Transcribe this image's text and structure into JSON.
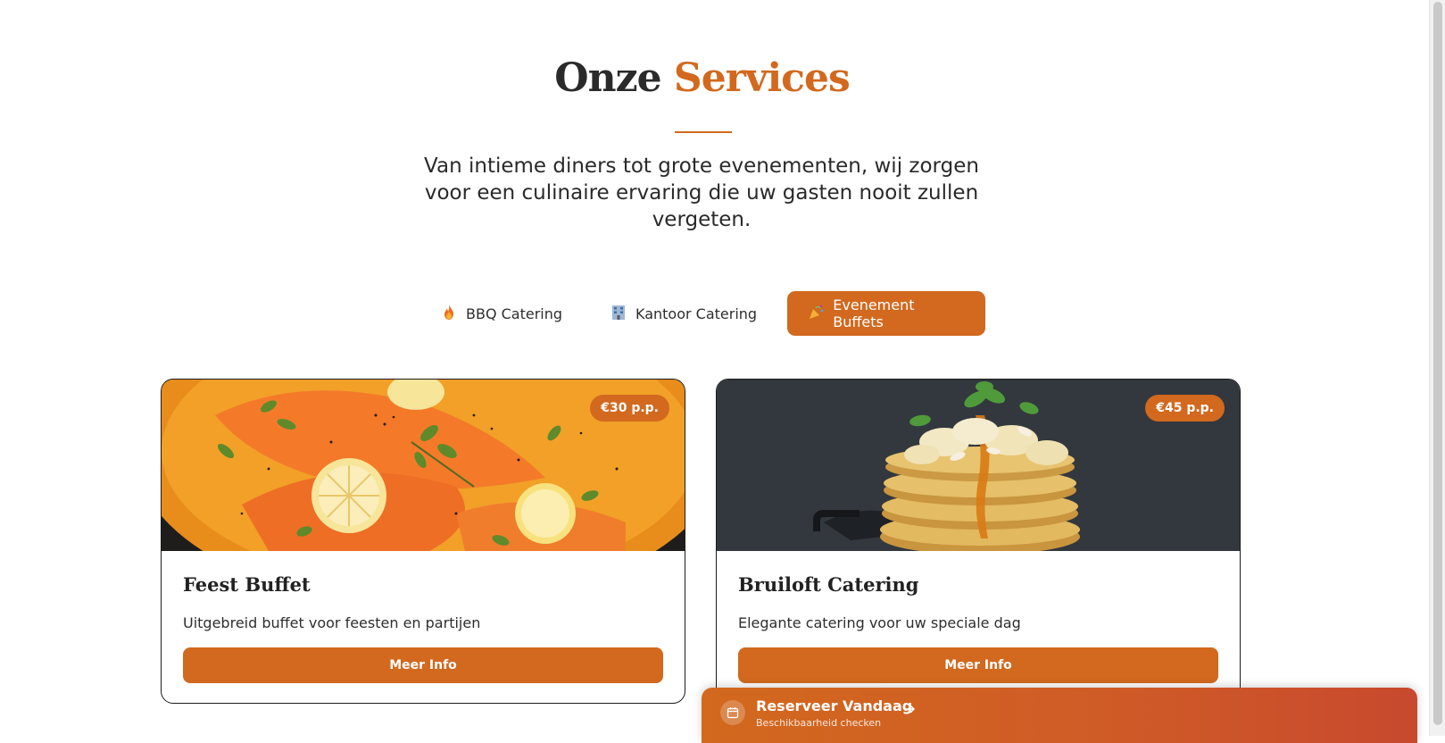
{
  "header": {
    "title_part1": "Onze",
    "title_part2": "Services",
    "subtitle": "Van intieme diners tot grote evenementen, wij zorgen voor een culinaire ervaring die uw gasten nooit zullen vergeten."
  },
  "tabs": [
    {
      "label": "BBQ Catering",
      "icon": "fire-icon",
      "active": false
    },
    {
      "label": "Kantoor Catering",
      "icon": "office-building-icon",
      "active": false
    },
    {
      "label": "Evenement Buffets",
      "icon": "party-popper-icon",
      "active": true
    }
  ],
  "cards": [
    {
      "title": "Feest Buffet",
      "description": "Uitgebreid buffet voor feesten en partijen",
      "price": "€30 p.p.",
      "button_label": "Meer Info",
      "image": "salmon-dish-photo"
    },
    {
      "title": "Bruiloft Catering",
      "description": "Elegante catering voor uw speciale dag",
      "price": "€45 p.p.",
      "button_label": "Meer Info",
      "image": "pancake-stack-photo"
    }
  ],
  "reserve": {
    "title": "Reserveer Vandaag",
    "subtitle": "Beschikbaarheid checken",
    "icon": "calendar-icon",
    "arrow_icon": "arrow-right-icon"
  },
  "colors": {
    "accent": "#d2691e",
    "text": "#2a2a2a",
    "background": "#ffffff"
  }
}
